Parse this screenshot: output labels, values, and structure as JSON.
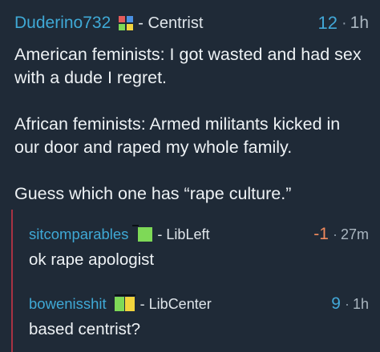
{
  "comments": [
    {
      "username": "Duderino732",
      "flair_icon": "authright-authleft-libleft-libright-quadrant-icon",
      "flair_label": "- Centrist",
      "score": "12",
      "dot": "·",
      "age": "1h",
      "paragraphs": [
        "American feminists: I got wasted and had sex with a dude I regret.",
        "African feminists: Armed militants kicked in our door and raped my whole family.",
        "Guess which one has “rape culture.”"
      ]
    },
    {
      "username": "sitcomparables",
      "flair_icon": "libleft-flair-icon",
      "flair_label": "- LibLeft",
      "score": "-1",
      "dot": "·",
      "age": "27m",
      "paragraphs": [
        "ok rape apologist"
      ]
    },
    {
      "username": "bowenisshit",
      "flair_icon": "libcenter-flair-icon",
      "flair_label": "- LibCenter",
      "score": "9",
      "dot": "·",
      "age": "1h",
      "paragraphs": [
        "based centrist?"
      ]
    }
  ],
  "colors": {
    "background": "#1f2a37",
    "username": "#3fa9d6",
    "score_positive": "#42a8d8",
    "score_negative": "#f08a5d",
    "thread_line": "#a83243"
  }
}
